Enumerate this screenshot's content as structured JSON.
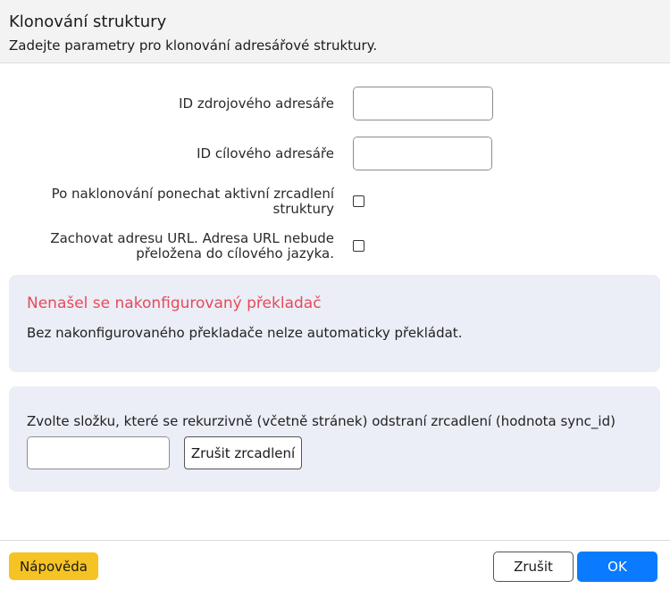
{
  "dialog": {
    "title": "Klonování struktury",
    "subtitle": "Zadejte parametry pro klonování adresářové struktury."
  },
  "form": {
    "source_dir": {
      "label": "ID zdrojového adresáře",
      "value": ""
    },
    "target_dir": {
      "label": "ID cílového adresáře",
      "value": ""
    },
    "keep_mirroring": {
      "label_line1": "Po naklonování ponechat aktivní zrcadlení",
      "label_line2": "struktury",
      "checked": false
    },
    "keep_url": {
      "label_line1": "Zachovat adresu URL. Adresa URL nebude",
      "label_line2": "přeložena do cílového jazyka.",
      "checked": false
    }
  },
  "translator_warning": {
    "title": "Nenašel se nakonfigurovaný překladač",
    "text": "Bez nakonfigurovaného překladače nelze automaticky překládat."
  },
  "sync_removal": {
    "text": "Zvolte složku, které se rekurzivně (včetně stránek) odstraní zrcadlení (hodnota sync_id)",
    "value": "",
    "button_label": "Zrušit zrcadlení"
  },
  "footer": {
    "help_label": "Nápověda",
    "cancel_label": "Zrušit",
    "ok_label": "OK"
  },
  "colors": {
    "accent": "#0a7bff",
    "help": "#f6c324",
    "warning": "#e64a5a",
    "panel_bg": "#ebeef6"
  },
  "icons": {
    "picker": "crosshair-icon"
  }
}
